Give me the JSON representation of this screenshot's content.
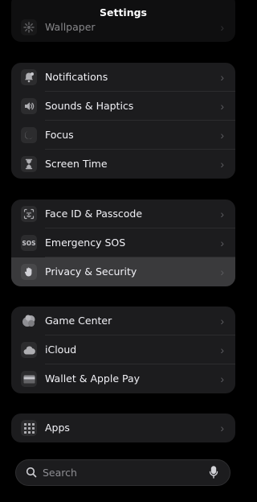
{
  "nav": {
    "title": "Settings"
  },
  "groups": {
    "top": {
      "rows": [
        {
          "label": "Wallpaper"
        }
      ]
    },
    "focus": {
      "rows": [
        {
          "label": "Notifications"
        },
        {
          "label": "Sounds & Haptics"
        },
        {
          "label": "Focus"
        },
        {
          "label": "Screen Time"
        }
      ]
    },
    "security": {
      "rows": [
        {
          "label": "Face ID & Passcode"
        },
        {
          "label": "Emergency SOS",
          "icon_text": "SOS"
        },
        {
          "label": "Privacy & Security"
        }
      ]
    },
    "services": {
      "rows": [
        {
          "label": "Game Center"
        },
        {
          "label": "iCloud"
        },
        {
          "label": "Wallet & Apple Pay"
        }
      ]
    },
    "apps": {
      "rows": [
        {
          "label": "Apps"
        }
      ]
    }
  },
  "chevron": "›",
  "search": {
    "placeholder": "Search"
  },
  "colors": {
    "icon_bg": "#2c2c2e",
    "selected_row": "#3a3a3c",
    "group_bg": "#1c1c1e"
  }
}
